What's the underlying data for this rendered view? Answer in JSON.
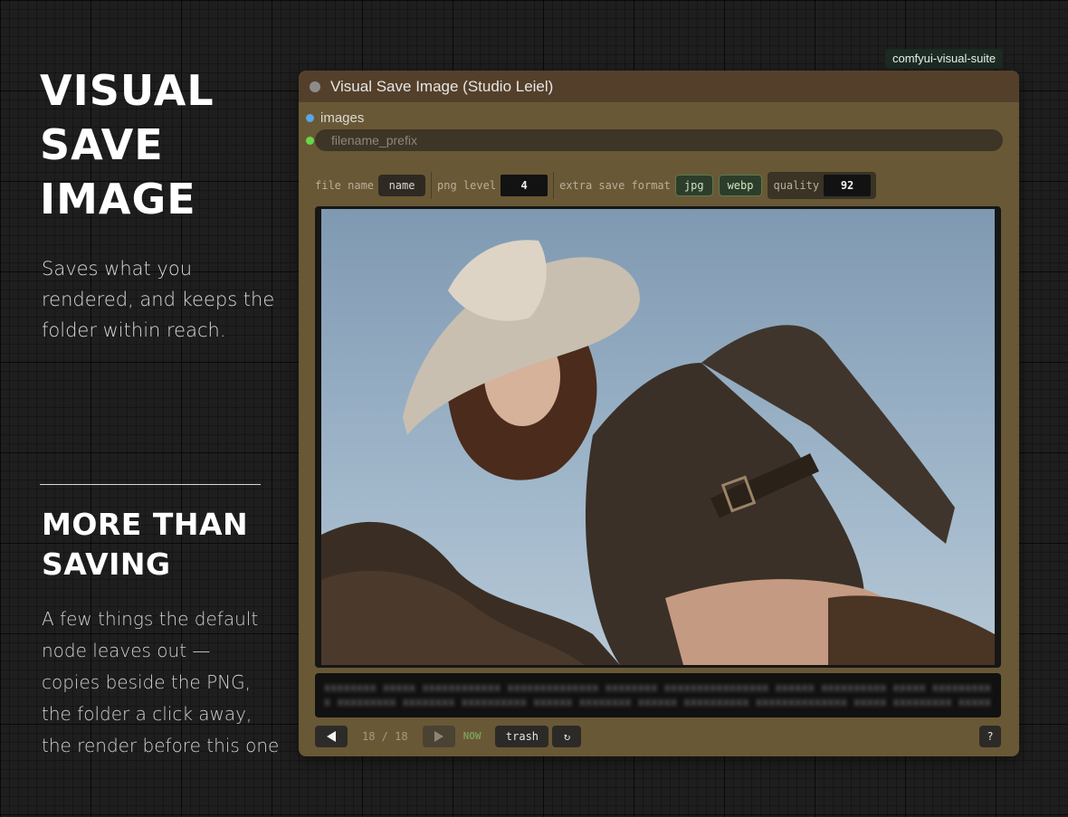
{
  "hero": {
    "title_lines": [
      "VISUAL",
      "SAVE",
      "IMAGE"
    ],
    "description": "Saves what you rendered, and keeps the folder within reach."
  },
  "section": {
    "title_lines": [
      "MORE THAN",
      "SAVING"
    ],
    "description_lines": [
      "A few things the default",
      "node leaves out —",
      "copies beside the PNG,",
      "the folder a click away,",
      "the render before this one"
    ]
  },
  "tag": "comfyui-visual-suite",
  "node": {
    "title": "Visual Save Image (Studio Leiel)",
    "slots": {
      "images": "images",
      "filename_prefix": "filename_prefix"
    },
    "toolbar": {
      "file_name_label": "file name",
      "file_name_value": "name",
      "png_level_label": "png level",
      "png_level_value": "4",
      "extra_format_label": "extra save format",
      "format_jpg": "jpg",
      "format_webp": "webp",
      "quality_label": "quality",
      "quality_value": "92"
    },
    "metadata_text": "xxxxxxxx xxxxx xxxxxxxxxxxx xxxxxxxxxxxxxx xxxxxxxx xxxxxxxxxxxxxxxx xxxxxx xxxxxxxxxx xxxxx xxxxxxxxxx xxxxxxxxx xxxxxxxx xxxxxxxxxx xxxxxx xxxxxxxx xxxxxx xxxxxxxxxx xxxxxxxxxxxxxx xxxxx xxxxxxxxx xxxxxxx xxxxxxxxxxxxxxxx xxxxxxxxx xx xxxx xxxxx xxxxxxxxx xxxxxxxx xxxxxxxx",
    "nav": {
      "counter": "18 / 18",
      "now": "NOW",
      "trash": "trash",
      "refresh_icon": "↻",
      "help": "?"
    }
  },
  "colors": {
    "node_body": "#695835",
    "node_header": "#54402a",
    "images_slot": "#5aa6e6",
    "prefix_slot": "#66d84a",
    "toggle_active": "#5d7a52"
  }
}
